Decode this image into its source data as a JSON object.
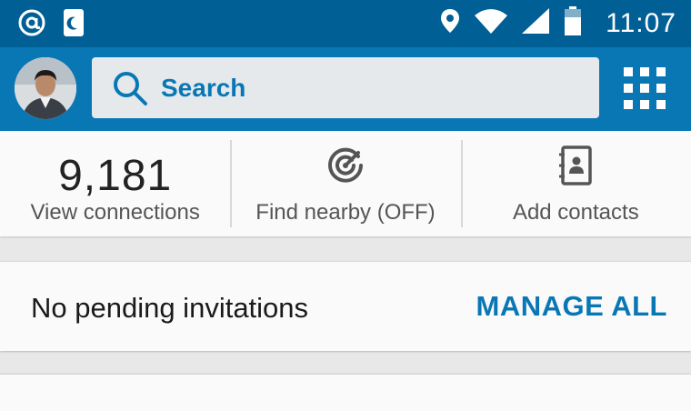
{
  "status_bar": {
    "time": "11:07",
    "icons": [
      "at-icon",
      "do-not-disturb-icon",
      "location-icon",
      "wifi-icon",
      "signal-icon",
      "battery-icon"
    ]
  },
  "app_bar": {
    "avatar": "profile-avatar",
    "search_placeholder": "Search",
    "menu_icon": "apps-grid-icon"
  },
  "stats": [
    {
      "value": "9,181",
      "label": "View connections"
    },
    {
      "icon": "radar-icon",
      "label": "Find nearby (OFF)"
    },
    {
      "icon": "address-book-icon",
      "label": "Add contacts"
    }
  ],
  "invitations": {
    "text": "No pending invitations",
    "action": "MANAGE ALL"
  },
  "colors": {
    "status_bar": "#005f95",
    "app_bar": "#0a77b5",
    "accent": "#0a77b5"
  }
}
